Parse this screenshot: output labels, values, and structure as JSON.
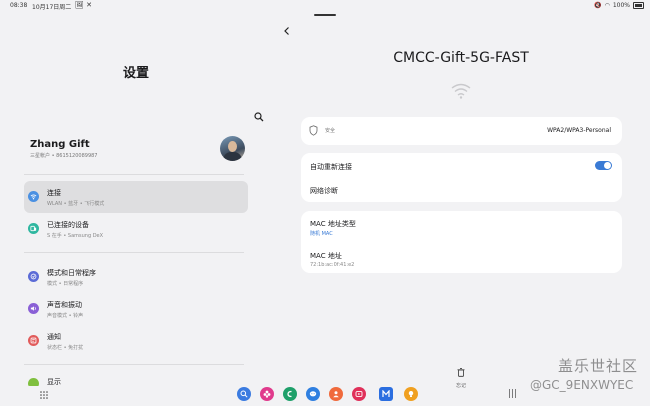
{
  "status_bar": {
    "time": "08:38",
    "date": "10月17日周二",
    "battery": "100%"
  },
  "settings": {
    "title": "设置",
    "profile": {
      "name": "Zhang Gift",
      "subtitle": "三星帐户 • 8615120089987"
    },
    "groups": [
      [
        {
          "label": "连接",
          "sub": "WLAN • 蓝牙 • 飞行模式",
          "icon": "wifi-icon",
          "color": "#4a90e2",
          "selected": true
        },
        {
          "label": "已连接的设备",
          "sub": "S 在手 • Samsung DeX",
          "icon": "connected-devices-icon",
          "color": "#2fb7a0",
          "selected": false
        }
      ],
      [
        {
          "label": "模式和日常程序",
          "sub": "模式 • 日常程序",
          "icon": "modes-icon",
          "color": "#5b6bd6",
          "selected": false
        },
        {
          "label": "声音和振动",
          "sub": "声音模式 • 铃声",
          "icon": "sound-icon",
          "color": "#8a60d6",
          "selected": false
        },
        {
          "label": "通知",
          "sub": "状态栏 • 免打扰",
          "icon": "notification-icon",
          "color": "#e15b5b",
          "selected": false
        }
      ],
      [
        {
          "label": "显示",
          "sub": "",
          "icon": "display-icon",
          "color": "#7fbf3e",
          "selected": false
        }
      ]
    ]
  },
  "network": {
    "ssid": "CMCC-Gift-5G-FAST",
    "security_label": "安全",
    "security_value": "WPA2/WPA3-Personal",
    "auto_reconnect_label": "自动重新连接",
    "auto_reconnect_on": true,
    "diagnostics_label": "网络诊断",
    "mac_type_label": "MAC 地址类型",
    "mac_type_value": "随机 MAC",
    "mac_address_label": "MAC 地址",
    "mac_address_value": "72:1b:ac:0f:41:e2",
    "delete_label": "忘记"
  },
  "dock": [
    {
      "name": "search-app-icon",
      "color": "#3b7be0"
    },
    {
      "name": "flower-app-icon",
      "color": "#e03a8c"
    },
    {
      "name": "phone-app-icon",
      "color": "#1fa06a"
    },
    {
      "name": "messages-app-icon",
      "color": "#2f7fe0"
    },
    {
      "name": "contacts-app-icon",
      "color": "#f06a3c"
    },
    {
      "name": "video-app-icon",
      "color": "#e0305a"
    },
    {
      "name": "samsung-members-app-icon",
      "color": "#2b6ee0"
    },
    {
      "name": "tips-app-icon",
      "color": "#f0a020"
    }
  ],
  "watermark": {
    "line1": "盖乐世社区",
    "line2": "@GC_9ENXWYEC"
  }
}
